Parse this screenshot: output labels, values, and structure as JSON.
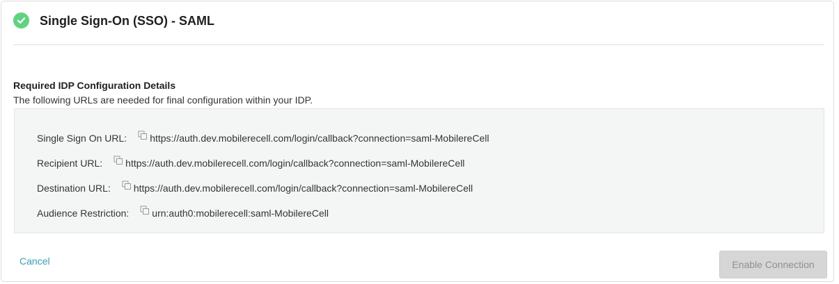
{
  "header": {
    "title": "Single Sign-On (SSO) - SAML",
    "status_color": "#5dd47e"
  },
  "section": {
    "title": "Required IDP Configuration Details",
    "description": "The following URLs are needed for final configuration within your IDP."
  },
  "details": [
    {
      "label": "Single Sign On URL:",
      "value": "https://auth.dev.mobilerecell.com/login/callback?connection=saml-MobilereCell",
      "icon": "copy-icon"
    },
    {
      "label": "Recipient URL:",
      "value": "https://auth.dev.mobilerecell.com/login/callback?connection=saml-MobilereCell",
      "icon": "copy-icon"
    },
    {
      "label": "Destination URL:",
      "value": "https://auth.dev.mobilerecell.com/login/callback?connection=saml-MobilereCell",
      "icon": "copy-icon"
    },
    {
      "label": "Audience Restriction:",
      "value": "urn:auth0:mobilerecell:saml-MobilereCell",
      "icon": "copy-icon"
    }
  ],
  "footer": {
    "cancel_label": "Cancel",
    "enable_label": "Enable Connection",
    "accent_color": "#2ea7c8"
  }
}
